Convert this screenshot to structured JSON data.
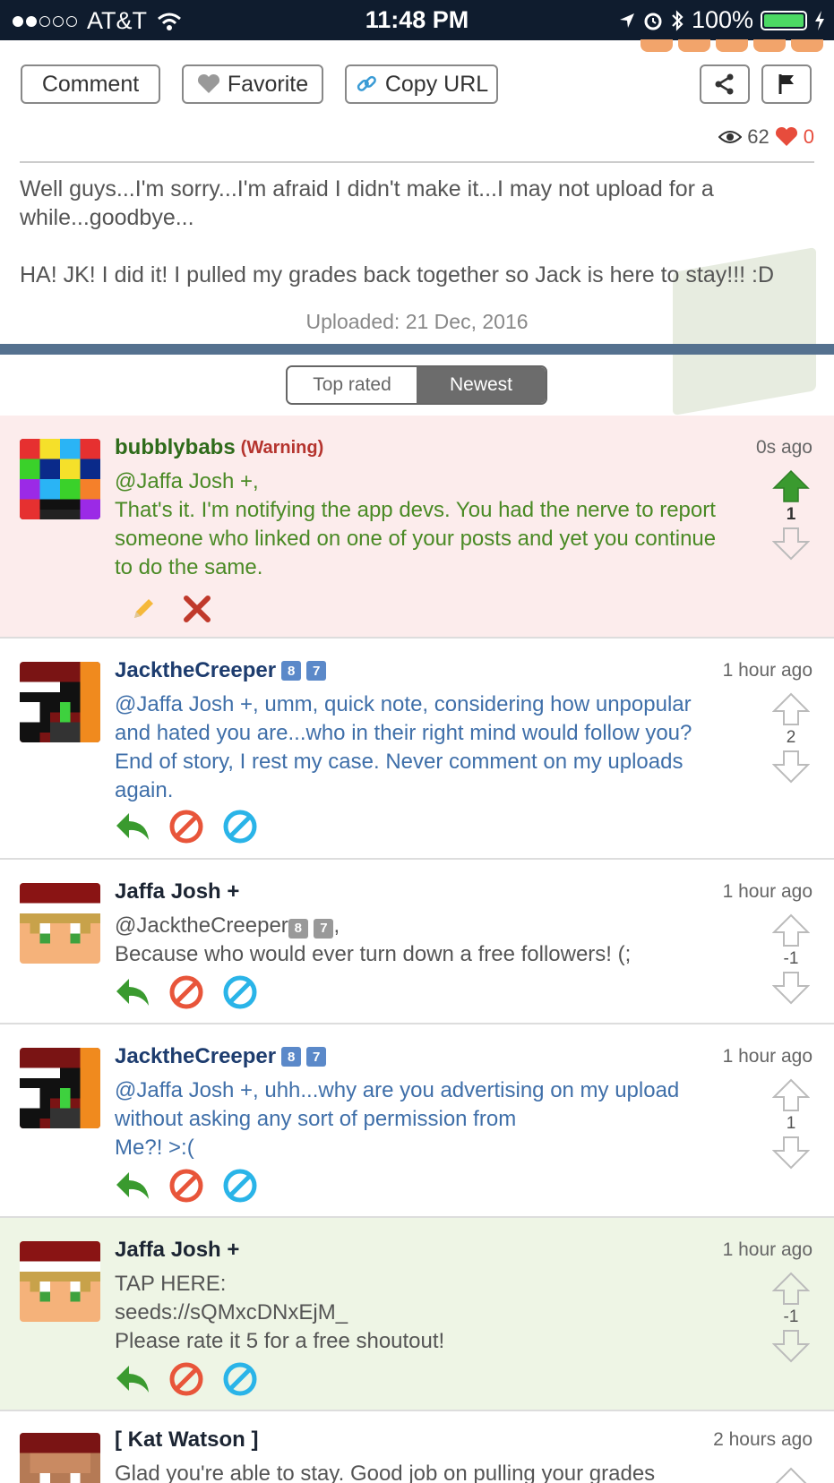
{
  "status_bar": {
    "carrier": "AT&T",
    "time": "11:48 PM",
    "battery": "100%"
  },
  "actions": {
    "comment": "Comment",
    "favorite": "Favorite",
    "copy_url": "Copy URL"
  },
  "stats": {
    "views": "62",
    "likes": "0"
  },
  "description": {
    "line1": "Well guys...I'm sorry...I'm afraid I didn't make it...I may not upload for a while...goodbye...",
    "line2": "HA! JK! I did it! I pulled my grades back together so Jack is here to stay!!! :D"
  },
  "uploaded": "Uploaded: 21 Dec, 2016",
  "sort": {
    "top_rated": "Top rated",
    "newest": "Newest"
  },
  "comments": [
    {
      "user": "bubblybabs",
      "warning": "(Warning)",
      "time": "0s ago",
      "text_line1": "@Jaffa Josh +,",
      "text_line2": "That's it. I'm notifying the app devs. You had the nerve to report someone who linked on one of your posts and yet you continue to do the same.",
      "votes": "1"
    },
    {
      "user": "JacktheCreeper",
      "badge1": "8",
      "badge2": "7",
      "time": "1 hour ago",
      "text": "@Jaffa Josh +, umm, quick note, considering how unpopular and hated you are...who in their right mind would follow you? End of story, I rest my case. Never comment on my uploads again.",
      "votes": "2"
    },
    {
      "user": "Jaffa Josh +",
      "time": "1 hour ago",
      "mention": "@JacktheCreeper",
      "badge1": "8",
      "badge2": "7",
      "mention_suffix": ",",
      "text": "Because who would ever turn down a free followers! (;",
      "votes": "-1"
    },
    {
      "user": "JacktheCreeper",
      "badge1": "8",
      "badge2": "7",
      "time": "1 hour ago",
      "text_line1": "@Jaffa Josh +, uhh...why are you advertising on my upload without asking any sort of permission from",
      "text_line2": "Me?! >:(",
      "votes": "1"
    },
    {
      "user": "Jaffa Josh +",
      "time": "1 hour ago",
      "text_line1": "TAP HERE:",
      "text_line2": "seeds://sQMxcDNxEjM_",
      "text_line3": "Please rate it 5 for a free shoutout!",
      "votes": "-1"
    },
    {
      "user": "[ Kat Watson ]",
      "time": "2 hours ago",
      "text": "Glad you're able to stay. Good job on pulling your grades"
    }
  ],
  "colors": {
    "status_bar": "#0f1c2e",
    "warning_row": "#fcecec",
    "highlight_row": "#eef5e5",
    "upvote_active": "#3a9a2f",
    "divider_blue": "#55718f"
  }
}
